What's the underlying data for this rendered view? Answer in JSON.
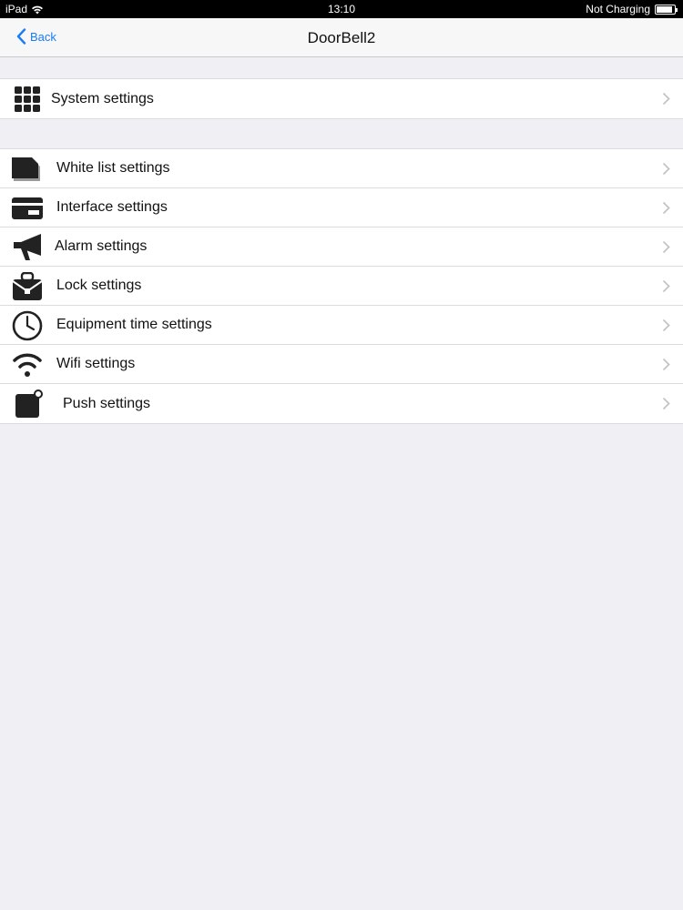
{
  "status_bar": {
    "device": "iPad",
    "time": "13:10",
    "charging_text": "Not Charging",
    "battery_level": 0.9
  },
  "nav": {
    "back_label": "Back",
    "title": "DoorBell2",
    "accent_color": "#1a7cf5"
  },
  "groups": [
    {
      "items": [
        {
          "label": "System settings",
          "icon": "grid-icon"
        }
      ]
    },
    {
      "items": [
        {
          "label": "White list settings",
          "icon": "whitelist-icon"
        },
        {
          "label": "Interface settings",
          "icon": "card-icon"
        },
        {
          "label": "Alarm settings",
          "icon": "megaphone-icon"
        },
        {
          "label": "Lock settings",
          "icon": "lock-bag-icon"
        },
        {
          "label": "Equipment time settings",
          "icon": "clock-icon"
        },
        {
          "label": "Wifi settings",
          "icon": "wifi-icon"
        },
        {
          "label": "Push settings",
          "icon": "push-icon"
        }
      ]
    }
  ]
}
